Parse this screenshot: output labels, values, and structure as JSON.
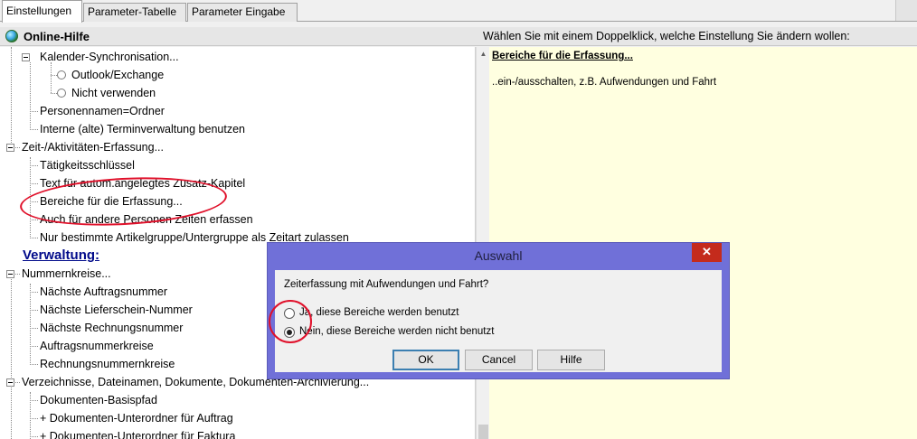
{
  "tabs": [
    {
      "label": "Einstellungen",
      "active": true
    },
    {
      "label": "Parameter-Tabelle",
      "active": false
    },
    {
      "label": "Parameter Eingabe",
      "active": false
    }
  ],
  "header": {
    "online_help": "Online-Hilfe",
    "hint": "Wählen Sie mit einem Doppelklick, welche Einstellung Sie ändern wollen:"
  },
  "tree": {
    "items": [
      {
        "label": "Kalender-Synchronisation..."
      },
      {
        "label": "Outlook/Exchange"
      },
      {
        "label": "Nicht verwenden"
      },
      {
        "label": "Personennamen=Ordner"
      },
      {
        "label": "Interne (alte) Terminverwaltung benutzen"
      },
      {
        "label": "Zeit-/Aktivitäten-Erfassung..."
      },
      {
        "label": "Tätigkeitsschlüssel"
      },
      {
        "label": "Text für autom.angelegtes Zusatz-Kapitel"
      },
      {
        "label": "Bereiche für die Erfassung..."
      },
      {
        "label": "Auch für andere Personen Zeiten erfassen"
      },
      {
        "label": "Nur bestimmte Artikelgruppe/Untergruppe als Zeitart zulassen"
      },
      {
        "label": "Nummernkreise..."
      },
      {
        "label": "Nächste Auftragsnummer"
      },
      {
        "label": "Nächste Lieferschein-Nummer"
      },
      {
        "label": "Nächste Rechnungsnummer"
      },
      {
        "label": "Auftragsnummerkreise"
      },
      {
        "label": "Rechnungsnummernkreise"
      },
      {
        "label": "Verzeichnisse, Dateinamen, Dokumente, Dokumenten-Archivierung..."
      },
      {
        "label": "Dokumenten-Basispfad"
      },
      {
        "label": "+ Dokumenten-Unterordner für Auftrag"
      },
      {
        "label": "+ Dokumenten-Unterordner für Faktura"
      }
    ],
    "section_heading": "Verwaltung:"
  },
  "help": {
    "title": "Bereiche für die Erfassung...",
    "description": "..ein-/ausschalten, z.B. Aufwendungen und Fahrt"
  },
  "dialog": {
    "title": "Auswahl",
    "close_glyph": "✕",
    "question": "Zeiterfassung mit Aufwendungen und Fahrt?",
    "options": [
      {
        "label": "Ja, diese Bereiche werden benutzt",
        "checked": false
      },
      {
        "label": "Nein, diese Bereiche werden nicht benutzt",
        "checked": true
      }
    ],
    "buttons": {
      "ok": "OK",
      "cancel": "Cancel",
      "help": "Hilfe"
    }
  },
  "colors": {
    "dialog_frame": "#7070d8",
    "help_background": "#ffffe0",
    "annotation": "#e0102a",
    "section_heading": "#000a8a"
  }
}
